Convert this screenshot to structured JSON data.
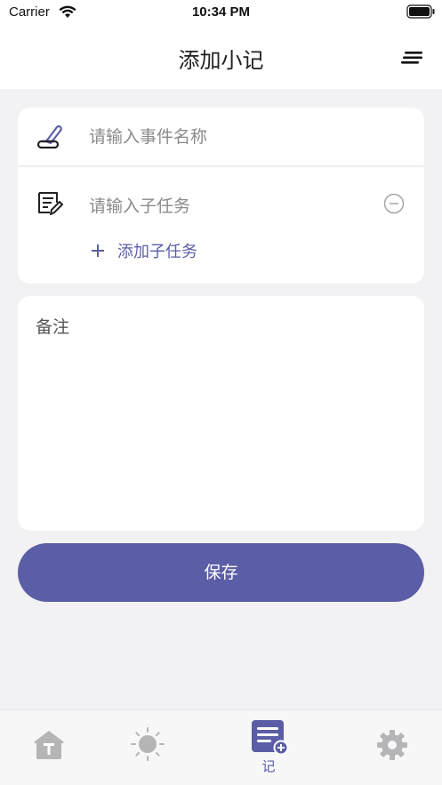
{
  "status_bar": {
    "carrier": "Carrier",
    "time": "10:34 PM"
  },
  "nav": {
    "title": "添加小记"
  },
  "form": {
    "event_name_placeholder": "请输入事件名称",
    "subtask_placeholder": "请输入子任务",
    "add_subtask_label": "添加子任务",
    "note_placeholder": "备注"
  },
  "save_label": "保存",
  "tabs": [
    {
      "icon": "home-icon",
      "label": ""
    },
    {
      "icon": "sun-icon",
      "label": ""
    },
    {
      "icon": "note-add-icon",
      "label": "记",
      "active": true
    },
    {
      "icon": "gear-icon",
      "label": ""
    }
  ],
  "colors": {
    "accent": "#5b5ea6",
    "background": "#f2f2f4",
    "inactive_icon": "#b5b5b8"
  }
}
